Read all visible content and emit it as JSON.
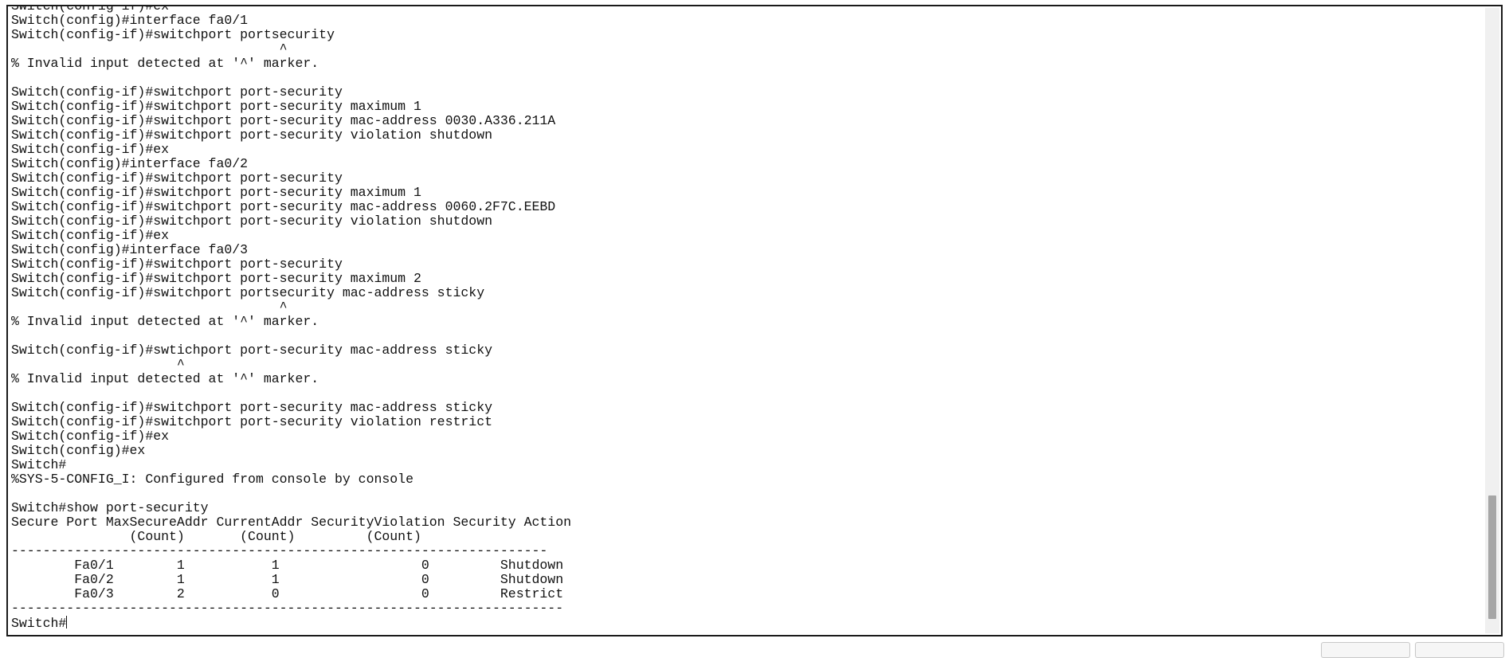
{
  "terminal": {
    "lines": [
      "Switch(config-if)#ex",
      "Switch(config)#interface fa0/1",
      "Switch(config-if)#switchport portsecurity",
      "                                  ^",
      "% Invalid input detected at '^' marker.",
      "",
      "Switch(config-if)#switchport port-security",
      "Switch(config-if)#switchport port-security maximum 1",
      "Switch(config-if)#switchport port-security mac-address 0030.A336.211A",
      "Switch(config-if)#switchport port-security violation shutdown",
      "Switch(config-if)#ex",
      "Switch(config)#interface fa0/2",
      "Switch(config-if)#switchport port-security",
      "Switch(config-if)#switchport port-security maximum 1",
      "Switch(config-if)#switchport port-security mac-address 0060.2F7C.EEBD",
      "Switch(config-if)#switchport port-security violation shutdown",
      "Switch(config-if)#ex",
      "Switch(config)#interface fa0/3",
      "Switch(config-if)#switchport port-security",
      "Switch(config-if)#switchport port-security maximum 2",
      "Switch(config-if)#switchport portsecurity mac-address sticky",
      "                                  ^",
      "% Invalid input detected at '^' marker.",
      "",
      "Switch(config-if)#swtichport port-security mac-address sticky",
      "                     ^",
      "% Invalid input detected at '^' marker.",
      "",
      "Switch(config-if)#switchport port-security mac-address sticky",
      "Switch(config-if)#switchport port-security violation restrict",
      "Switch(config-if)#ex",
      "Switch(config)#ex",
      "Switch#",
      "%SYS-5-CONFIG_I: Configured from console by console",
      "",
      "Switch#show port-security",
      "Secure Port MaxSecureAddr CurrentAddr SecurityViolation Security Action",
      "               (Count)       (Count)         (Count)",
      "--------------------------------------------------------------------",
      "        Fa0/1        1           1                  0         Shutdown",
      "        Fa0/2        1           1                  0         Shutdown",
      "        Fa0/3        2           0                  0         Restrict",
      "----------------------------------------------------------------------",
      "Switch#"
    ]
  }
}
